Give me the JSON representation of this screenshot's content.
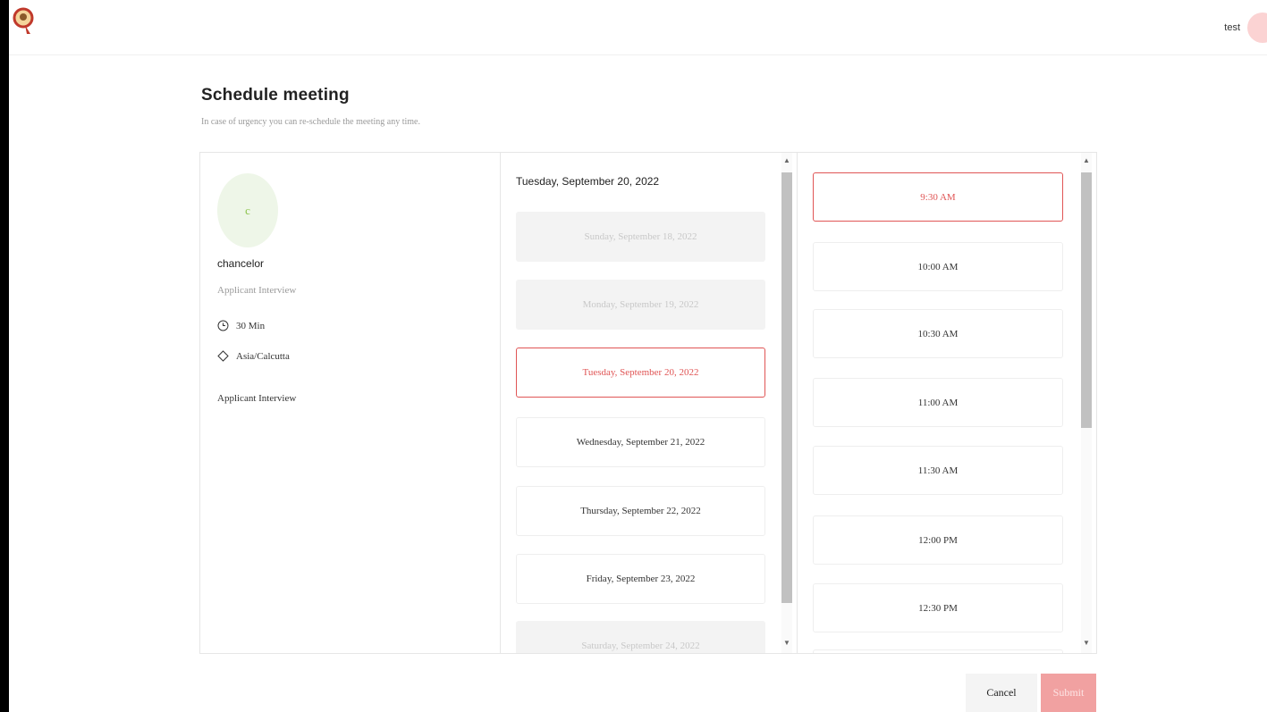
{
  "header": {
    "user_name": "test"
  },
  "page": {
    "title": "Schedule meeting",
    "subtitle": "In case of urgency you can re-schedule the meeting any time."
  },
  "host": {
    "initial": "c",
    "name": "chancelor",
    "event_type": "Applicant Interview",
    "duration": "30 Min",
    "timezone": "Asia/Calcutta",
    "description": "Applicant Interview"
  },
  "dates": {
    "selected_header": "Tuesday, September 20, 2022",
    "items": [
      {
        "label": "Sunday, September 18, 2022",
        "state": "disabled"
      },
      {
        "label": "Monday, September 19, 2022",
        "state": "disabled"
      },
      {
        "label": "Tuesday, September 20, 2022",
        "state": "selected"
      },
      {
        "label": "Wednesday, September 21, 2022",
        "state": "available"
      },
      {
        "label": "Thursday, September 22, 2022",
        "state": "available"
      },
      {
        "label": "Friday, September 23, 2022",
        "state": "available"
      },
      {
        "label": "Saturday, September 24, 2022",
        "state": "disabled"
      }
    ]
  },
  "times": {
    "items": [
      {
        "label": "9:30 AM",
        "state": "selected"
      },
      {
        "label": "10:00 AM",
        "state": "available"
      },
      {
        "label": "10:30 AM",
        "state": "available"
      },
      {
        "label": "11:00 AM",
        "state": "available"
      },
      {
        "label": "11:30 AM",
        "state": "available"
      },
      {
        "label": "12:00 PM",
        "state": "available"
      },
      {
        "label": "12:30 PM",
        "state": "available"
      }
    ]
  },
  "actions": {
    "cancel_label": "Cancel",
    "submit_label": "Submit"
  },
  "colors": {
    "accent": "#e05555",
    "submit_bg": "#f1a1a1",
    "avatar_bg": "#eef6e8"
  },
  "icons": {
    "duration": "clock-icon",
    "timezone": "globe-icon"
  }
}
